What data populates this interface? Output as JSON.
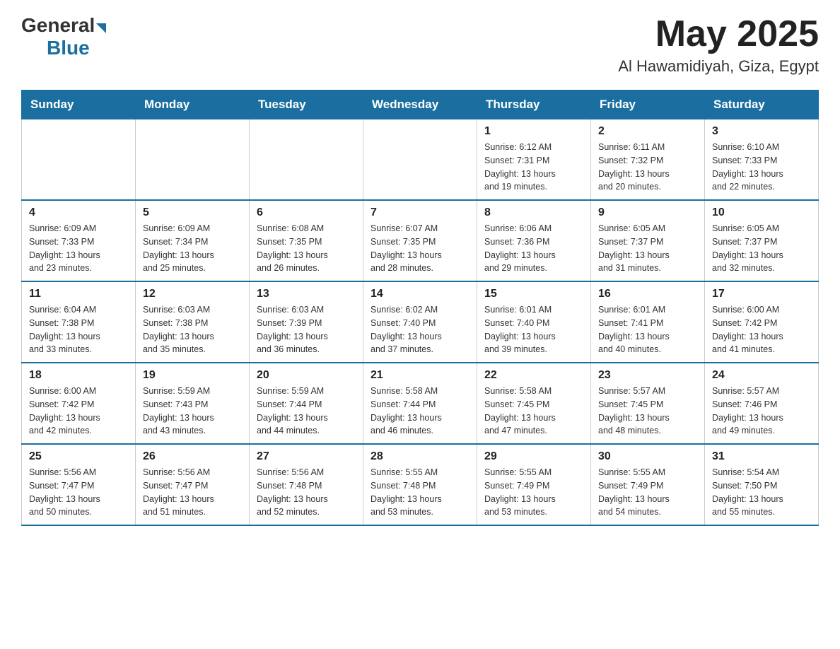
{
  "header": {
    "logo_general": "General",
    "logo_blue": "Blue",
    "month_title": "May 2025",
    "location": "Al Hawamidiyah, Giza, Egypt"
  },
  "days_of_week": [
    "Sunday",
    "Monday",
    "Tuesday",
    "Wednesday",
    "Thursday",
    "Friday",
    "Saturday"
  ],
  "weeks": [
    [
      {
        "day": "",
        "info": ""
      },
      {
        "day": "",
        "info": ""
      },
      {
        "day": "",
        "info": ""
      },
      {
        "day": "",
        "info": ""
      },
      {
        "day": "1",
        "info": "Sunrise: 6:12 AM\nSunset: 7:31 PM\nDaylight: 13 hours\nand 19 minutes."
      },
      {
        "day": "2",
        "info": "Sunrise: 6:11 AM\nSunset: 7:32 PM\nDaylight: 13 hours\nand 20 minutes."
      },
      {
        "day": "3",
        "info": "Sunrise: 6:10 AM\nSunset: 7:33 PM\nDaylight: 13 hours\nand 22 minutes."
      }
    ],
    [
      {
        "day": "4",
        "info": "Sunrise: 6:09 AM\nSunset: 7:33 PM\nDaylight: 13 hours\nand 23 minutes."
      },
      {
        "day": "5",
        "info": "Sunrise: 6:09 AM\nSunset: 7:34 PM\nDaylight: 13 hours\nand 25 minutes."
      },
      {
        "day": "6",
        "info": "Sunrise: 6:08 AM\nSunset: 7:35 PM\nDaylight: 13 hours\nand 26 minutes."
      },
      {
        "day": "7",
        "info": "Sunrise: 6:07 AM\nSunset: 7:35 PM\nDaylight: 13 hours\nand 28 minutes."
      },
      {
        "day": "8",
        "info": "Sunrise: 6:06 AM\nSunset: 7:36 PM\nDaylight: 13 hours\nand 29 minutes."
      },
      {
        "day": "9",
        "info": "Sunrise: 6:05 AM\nSunset: 7:37 PM\nDaylight: 13 hours\nand 31 minutes."
      },
      {
        "day": "10",
        "info": "Sunrise: 6:05 AM\nSunset: 7:37 PM\nDaylight: 13 hours\nand 32 minutes."
      }
    ],
    [
      {
        "day": "11",
        "info": "Sunrise: 6:04 AM\nSunset: 7:38 PM\nDaylight: 13 hours\nand 33 minutes."
      },
      {
        "day": "12",
        "info": "Sunrise: 6:03 AM\nSunset: 7:38 PM\nDaylight: 13 hours\nand 35 minutes."
      },
      {
        "day": "13",
        "info": "Sunrise: 6:03 AM\nSunset: 7:39 PM\nDaylight: 13 hours\nand 36 minutes."
      },
      {
        "day": "14",
        "info": "Sunrise: 6:02 AM\nSunset: 7:40 PM\nDaylight: 13 hours\nand 37 minutes."
      },
      {
        "day": "15",
        "info": "Sunrise: 6:01 AM\nSunset: 7:40 PM\nDaylight: 13 hours\nand 39 minutes."
      },
      {
        "day": "16",
        "info": "Sunrise: 6:01 AM\nSunset: 7:41 PM\nDaylight: 13 hours\nand 40 minutes."
      },
      {
        "day": "17",
        "info": "Sunrise: 6:00 AM\nSunset: 7:42 PM\nDaylight: 13 hours\nand 41 minutes."
      }
    ],
    [
      {
        "day": "18",
        "info": "Sunrise: 6:00 AM\nSunset: 7:42 PM\nDaylight: 13 hours\nand 42 minutes."
      },
      {
        "day": "19",
        "info": "Sunrise: 5:59 AM\nSunset: 7:43 PM\nDaylight: 13 hours\nand 43 minutes."
      },
      {
        "day": "20",
        "info": "Sunrise: 5:59 AM\nSunset: 7:44 PM\nDaylight: 13 hours\nand 44 minutes."
      },
      {
        "day": "21",
        "info": "Sunrise: 5:58 AM\nSunset: 7:44 PM\nDaylight: 13 hours\nand 46 minutes."
      },
      {
        "day": "22",
        "info": "Sunrise: 5:58 AM\nSunset: 7:45 PM\nDaylight: 13 hours\nand 47 minutes."
      },
      {
        "day": "23",
        "info": "Sunrise: 5:57 AM\nSunset: 7:45 PM\nDaylight: 13 hours\nand 48 minutes."
      },
      {
        "day": "24",
        "info": "Sunrise: 5:57 AM\nSunset: 7:46 PM\nDaylight: 13 hours\nand 49 minutes."
      }
    ],
    [
      {
        "day": "25",
        "info": "Sunrise: 5:56 AM\nSunset: 7:47 PM\nDaylight: 13 hours\nand 50 minutes."
      },
      {
        "day": "26",
        "info": "Sunrise: 5:56 AM\nSunset: 7:47 PM\nDaylight: 13 hours\nand 51 minutes."
      },
      {
        "day": "27",
        "info": "Sunrise: 5:56 AM\nSunset: 7:48 PM\nDaylight: 13 hours\nand 52 minutes."
      },
      {
        "day": "28",
        "info": "Sunrise: 5:55 AM\nSunset: 7:48 PM\nDaylight: 13 hours\nand 53 minutes."
      },
      {
        "day": "29",
        "info": "Sunrise: 5:55 AM\nSunset: 7:49 PM\nDaylight: 13 hours\nand 53 minutes."
      },
      {
        "day": "30",
        "info": "Sunrise: 5:55 AM\nSunset: 7:49 PM\nDaylight: 13 hours\nand 54 minutes."
      },
      {
        "day": "31",
        "info": "Sunrise: 5:54 AM\nSunset: 7:50 PM\nDaylight: 13 hours\nand 55 minutes."
      }
    ]
  ]
}
